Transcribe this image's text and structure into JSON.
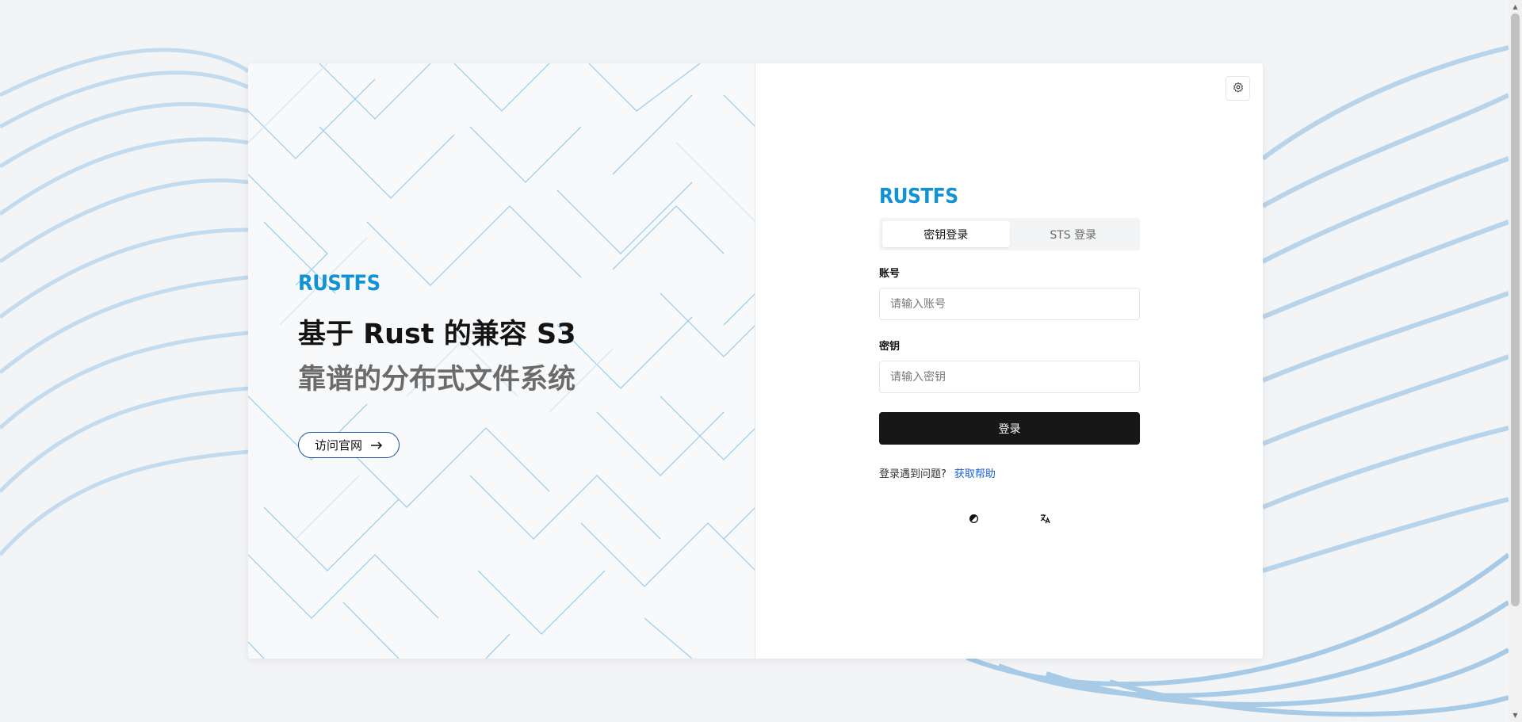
{
  "brand": {
    "logo_text": "RUSTFS"
  },
  "hero": {
    "headline_line1": "基于 Rust 的兼容 S3",
    "headline_line2": "靠谱的分布式文件系统",
    "visit_button_label": "访问官网"
  },
  "login": {
    "tabs": [
      {
        "label": "密钥登录",
        "active": true
      },
      {
        "label": "STS 登录",
        "active": false
      }
    ],
    "account_label": "账号",
    "account_placeholder": "请输入账号",
    "secret_label": "密钥",
    "secret_placeholder": "请输入密钥",
    "submit_label": "登录",
    "help_prompt": "登录遇到问题?",
    "help_link": "获取帮助"
  },
  "icons": {
    "settings": "gear-icon",
    "theme": "theme-toggle-icon",
    "language": "translate-icon",
    "visit_arrow": "arrow-right-icon"
  },
  "colors": {
    "brand_blue": "#1192d4",
    "primary_button": "#171717",
    "link_blue": "#1d5fd6",
    "visit_border": "#1c4fa0"
  }
}
